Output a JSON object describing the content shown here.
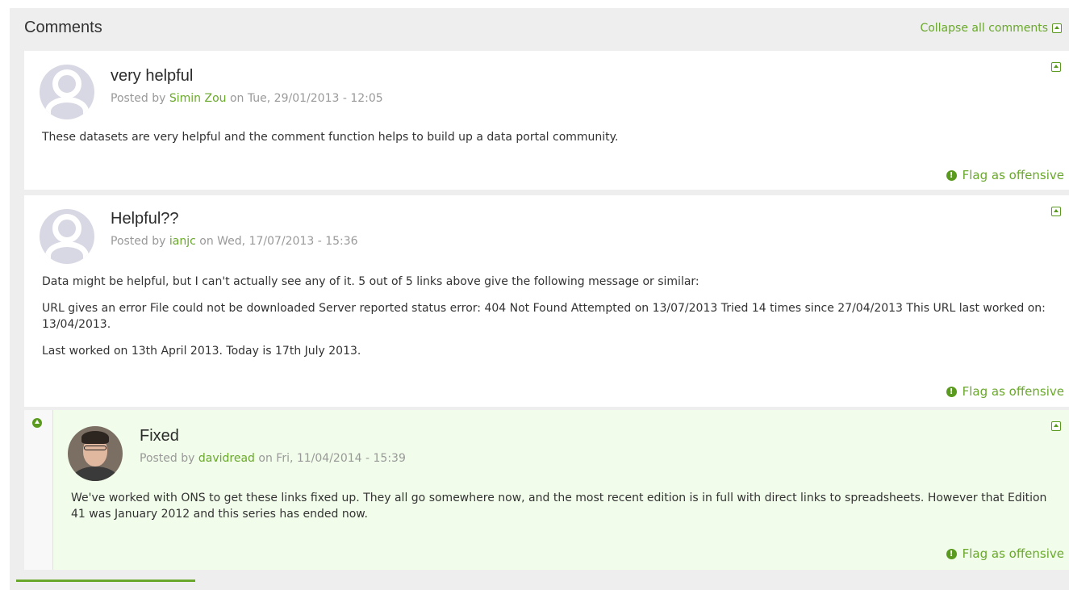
{
  "header": {
    "title": "Comments",
    "collapse_all_label": "Collapse all comments"
  },
  "comments": [
    {
      "title": "very helpful",
      "posted_by": "Posted by",
      "author": "Simin Zou",
      "date": "on Tue, 29/01/2013 - 12:05",
      "body": [
        "These datasets are very helpful and the comment function helps to build up a data portal community."
      ],
      "flag_label": "Flag as offensive"
    },
    {
      "title": "Helpful??",
      "posted_by": "Posted by",
      "author": "ianjc",
      "date": "on Wed, 17/07/2013 - 15:36",
      "body": [
        "Data might be helpful, but I can't actually see any of it.  5 out of 5 links above give the following message or similar:",
        "URL gives an error File could not be downloaded Server reported status error: 404 Not Found Attempted on 13/07/2013 Tried 14 times since 27/04/2013 This URL last worked on: 13/04/2013.",
        "Last worked on 13th April 2013. Today is 17th July 2013."
      ],
      "flag_label": "Flag as offensive"
    },
    {
      "title": "Fixed",
      "posted_by": "Posted by",
      "author": "davidread",
      "date": "on Fri, 11/04/2014 - 15:39",
      "body": [
        "We've worked with ONS to get these links fixed up. They all go somewhere now, and the most recent edition is in full with direct links to spreadsheets. However that Edition 41 was January 2012 and this series has ended now."
      ],
      "flag_label": "Flag as offensive"
    }
  ],
  "icons": {
    "collapse": "collapse-box-icon",
    "flag": "exclamation-circle-icon",
    "parent": "arrow-up-circle-icon",
    "avatar_default": "user-placeholder-icon"
  },
  "colors": {
    "accent": "#6aa82c",
    "reply_background": "#f1fdea",
    "panel_background": "#eeeeee",
    "meta_text": "#999999"
  }
}
